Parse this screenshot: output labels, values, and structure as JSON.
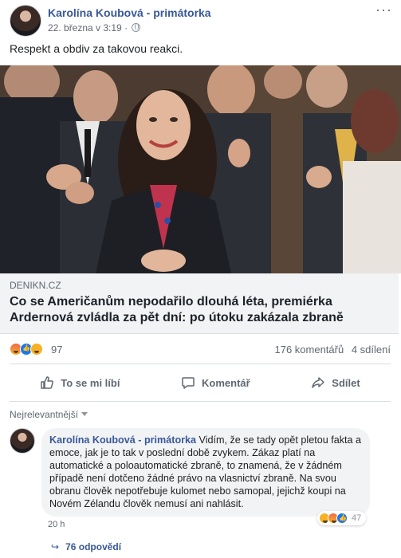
{
  "post": {
    "author": "Karolína Koubová - primátorka",
    "timestamp": "22. března v 3:19 ·",
    "more_label": "···",
    "status": "Respekt a obdiv za takovou reakci.",
    "photo_icon": "photo-of-woman-smiling-with-applauding-crowd"
  },
  "link": {
    "domain": "DENIKN.CZ",
    "title": "Co se Američanům nepodařilo dlouhá léta, premiérka Ardernová zvládla za pět dní: po útoku zakázala zbraně"
  },
  "summary": {
    "reaction_icons": [
      "angry-icon",
      "like-icon",
      "haha-icon"
    ],
    "reaction_count": "97",
    "comments": "176 komentářů",
    "shares": "4 sdílení"
  },
  "actions": {
    "like": "To se mi líbí",
    "comment": "Komentář",
    "share": "Sdílet"
  },
  "comments_section": {
    "sort_label": "Nejrelevantnější",
    "comment": {
      "author": "Karolína Koubová - primátorka",
      "text": "Vidím, že se tady opět pletou fakta a emoce, jak je to tak v poslední době zvykem. Zákaz platí na automatické a poloautomatické zbraně, to znamená, že v žádném případě není dotčeno žádné právo na vlasnictví zbraně. Na svou obranu člověk nepotřebuje kulomet nebo samopal, jejichž koupi na Novém Zélandu člověk nemusí ani nahlásit.",
      "reaction_count": "47",
      "time": "20 h",
      "replies": "76 odpovědí"
    }
  },
  "colors": {
    "link_blue": "#385898",
    "gray_text": "#606770",
    "preview_bg": "#f2f3f5"
  }
}
